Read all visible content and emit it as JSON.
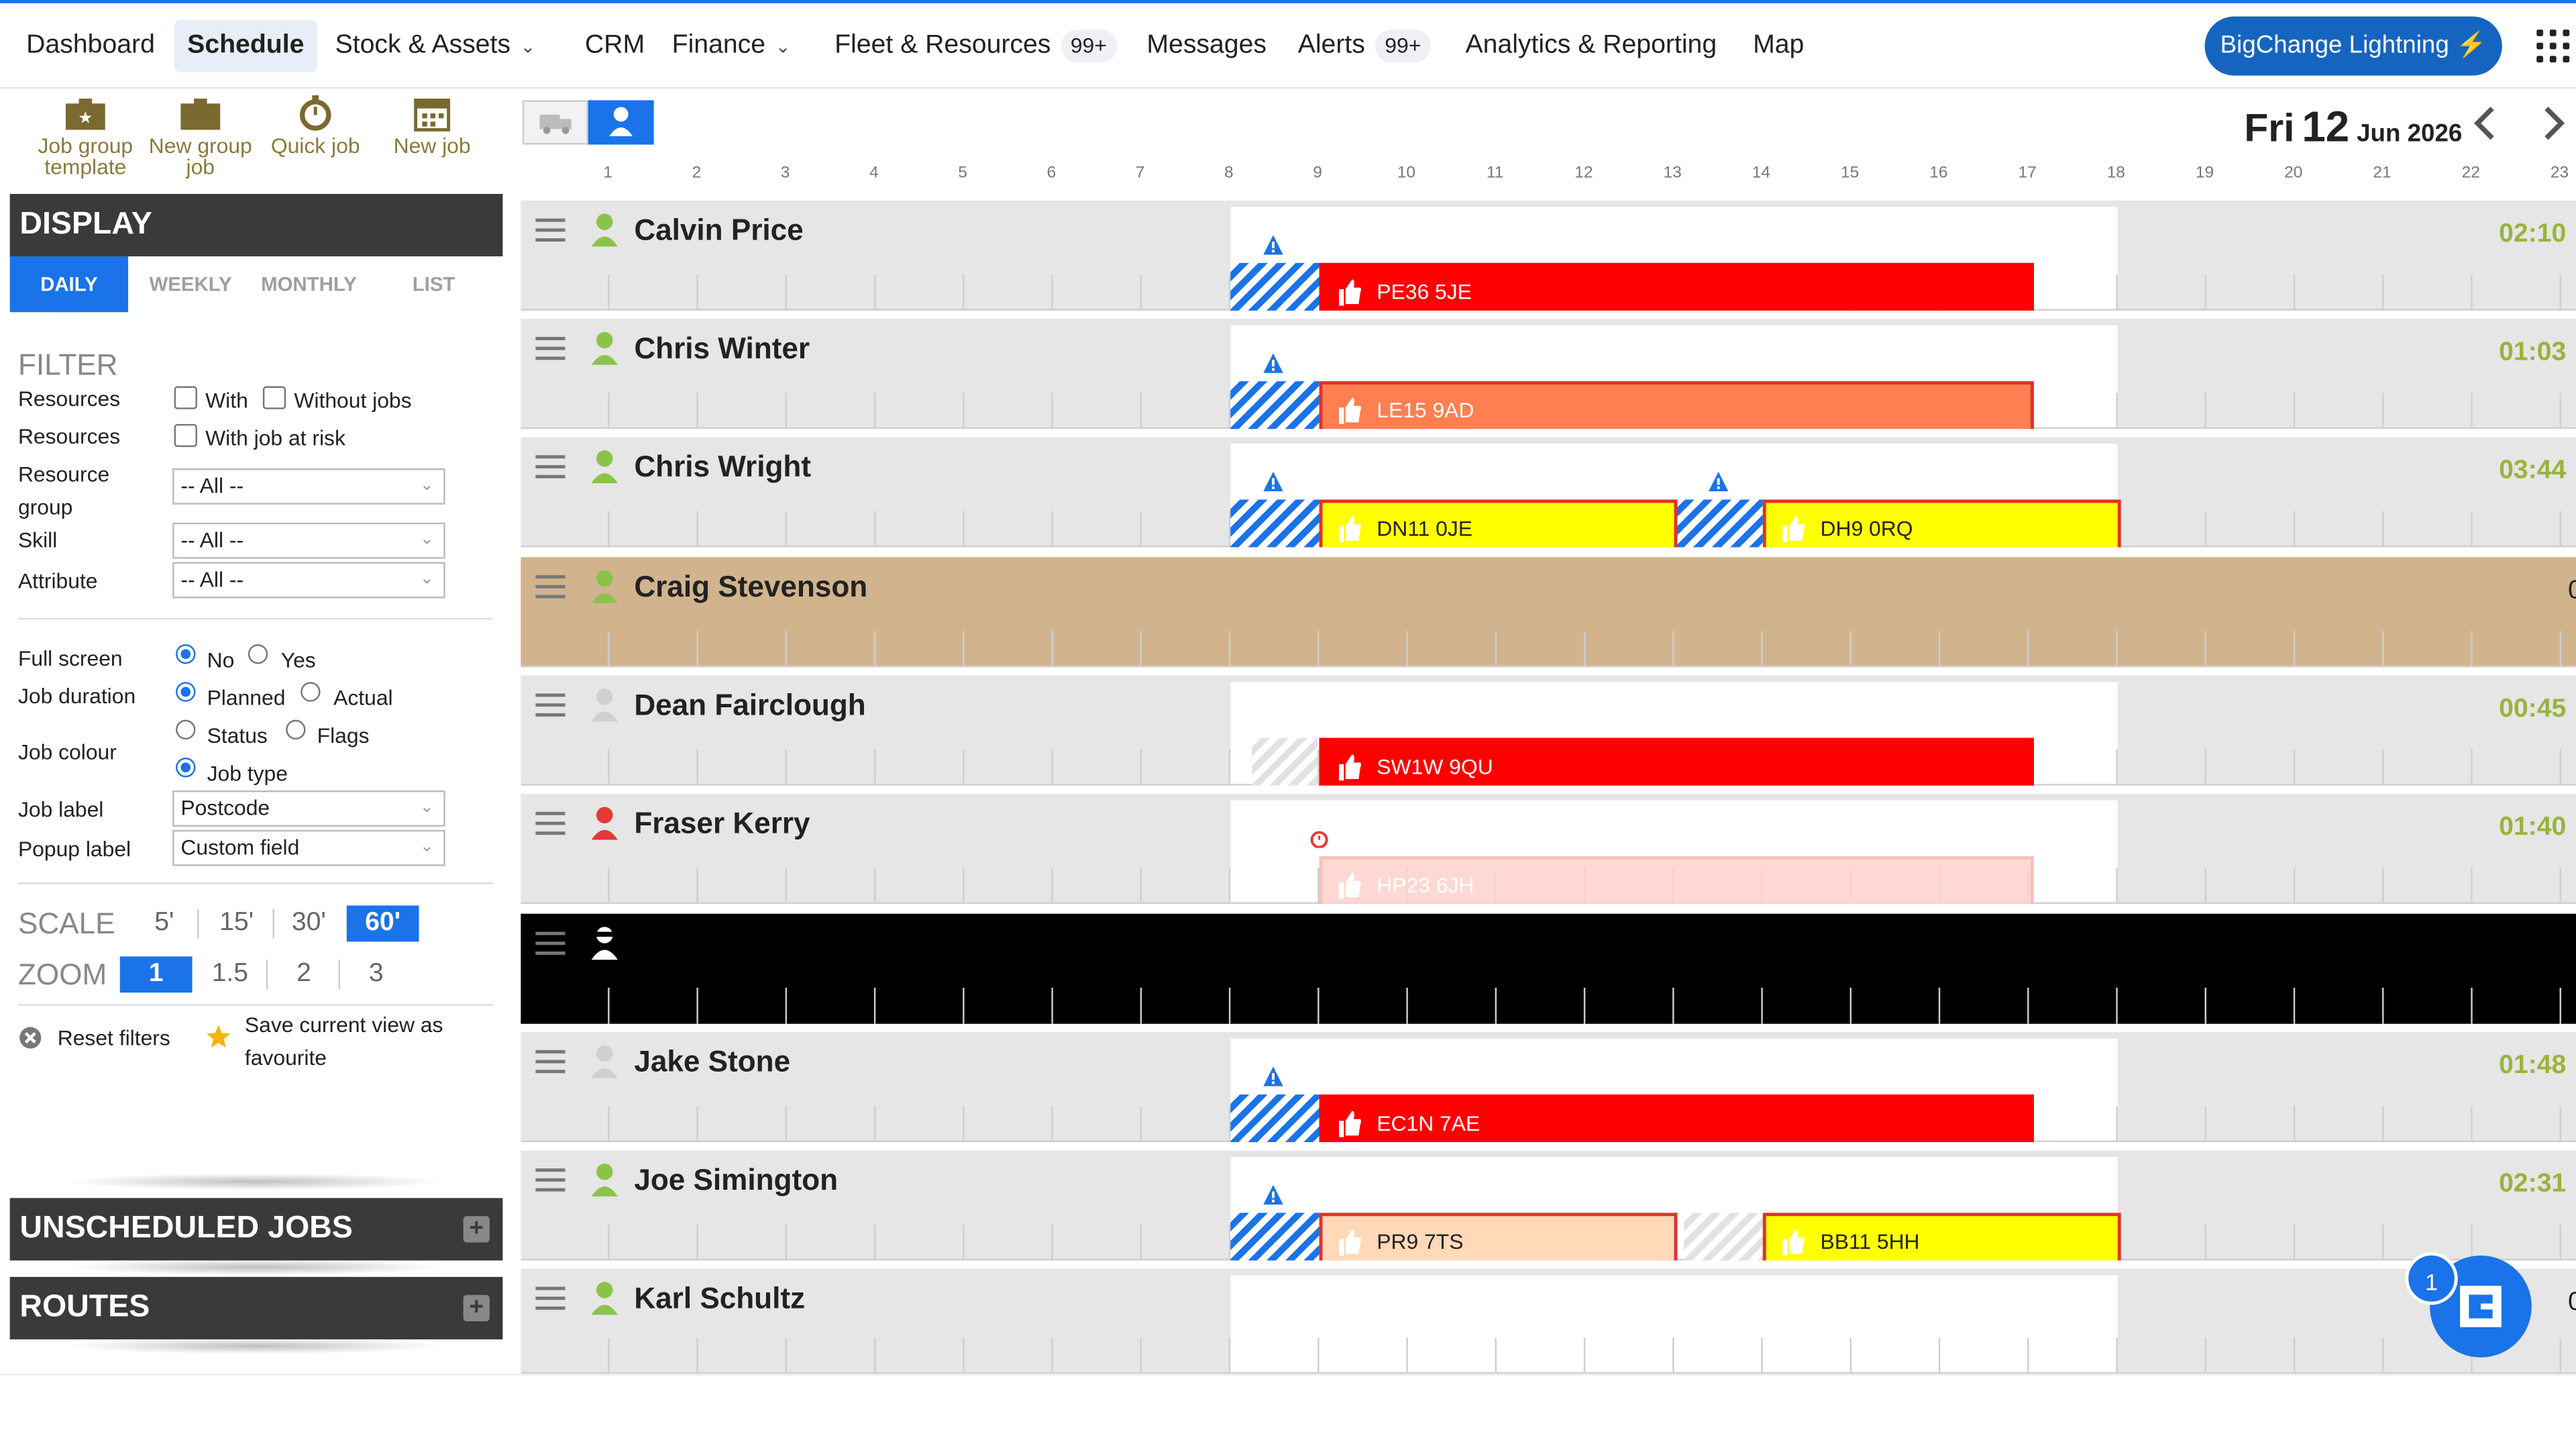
{
  "nav": {
    "items": [
      {
        "label": "Dashboard"
      },
      {
        "label": "Schedule"
      },
      {
        "label": "Stock & Assets"
      },
      {
        "label": "CRM"
      },
      {
        "label": "Finance"
      },
      {
        "label": "Fleet & Resources",
        "badge": "99+"
      },
      {
        "label": "Messages"
      },
      {
        "label": "Alerts",
        "badge": "99+"
      },
      {
        "label": "Analytics & Reporting"
      },
      {
        "label": "Map"
      }
    ],
    "lightning_label": "BigChange Lightning ⚡"
  },
  "toolbar": {
    "job_group_template": "Job group template",
    "new_group_job": "New group job",
    "quick_job": "Quick job",
    "new_job": "New job"
  },
  "date": {
    "day": "Fri",
    "num": "12",
    "monthyear": "Jun 2026"
  },
  "hours": [
    "1",
    "2",
    "3",
    "4",
    "5",
    "6",
    "7",
    "8",
    "9",
    "10",
    "11",
    "12",
    "13",
    "14",
    "15",
    "16",
    "17",
    "18",
    "19",
    "20",
    "21",
    "22",
    "23"
  ],
  "display": {
    "title": "DISPLAY",
    "tabs": [
      "DAILY",
      "WEEKLY",
      "MONTHLY",
      "LIST"
    ],
    "filter_title": "FILTER",
    "resources_label": "Resources",
    "with_label": "With",
    "without_jobs_label": "Without jobs",
    "resources2_label": "Resources",
    "with_job_at_risk_label": "With job at risk",
    "resource_group_label": "Resource group",
    "resource_group_value": "-- All --",
    "skill_label": "Skill",
    "skill_value": "-- All --",
    "attribute_label": "Attribute",
    "attribute_value": "-- All --",
    "full_screen_label": "Full screen",
    "no_label": "No",
    "yes_label": "Yes",
    "job_duration_label": "Job duration",
    "planned_label": "Planned",
    "actual_label": "Actual",
    "job_colour_label": "Job colour",
    "status_label": "Status",
    "flags_label": "Flags",
    "job_type_label": "Job type",
    "job_label_label": "Job label",
    "job_label_value": "Postcode",
    "popup_label_label": "Popup label",
    "popup_label_value": "Custom field",
    "scale_label": "SCALE",
    "scale_options": [
      "5'",
      "15'",
      "30'",
      "60'"
    ],
    "zoom_label": "ZOOM",
    "zoom_options": [
      "1",
      "1.5",
      "2",
      "3"
    ],
    "reset_filters": "Reset filters",
    "save_view": "Save current view as favourite"
  },
  "unscheduled_title": "UNSCHEDULED JOBS",
  "routes_title": "ROUTES",
  "resources": [
    {
      "name": "Calvin Price",
      "time": "02:10"
    },
    {
      "name": "Chris Winter",
      "time": "01:03"
    },
    {
      "name": "Chris Wright",
      "time": "03:44"
    },
    {
      "name": "Craig Stevenson",
      "time": "0"
    },
    {
      "name": "Dean Fairclough",
      "time": "00:45"
    },
    {
      "name": "Fraser Kerry",
      "time": "01:40"
    },
    {
      "name": "",
      "time": ""
    },
    {
      "name": "Jake Stone",
      "time": "01:48"
    },
    {
      "name": "Joe Simington",
      "time": "02:31"
    },
    {
      "name": "Karl Schultz",
      "time": "0"
    }
  ],
  "jobs": [
    {
      "code": "PE36 5JE",
      "color": "#ff0000"
    },
    {
      "code": "LE15 9AD",
      "color": "#ff7f50"
    },
    {
      "code": "DN11 0JE",
      "color": "#ffff00"
    },
    {
      "code": "DH9 0RQ",
      "color": "#ffff00"
    },
    {
      "code": "SW1W 9QU",
      "color": "#ff0000"
    },
    {
      "code": "HP23 6JH",
      "color": "#ffd2cc"
    },
    {
      "code": "EC1N 7AE",
      "color": "#ff0000"
    },
    {
      "code": "PR9 7TS",
      "color": "#ffd9b8"
    },
    {
      "code": "BB11 5HH",
      "color": "#ffff00"
    }
  ],
  "chat_badge": "1",
  "colors": {
    "accent": "#1a73e8",
    "row_highlight": "#d1b48e",
    "time_green": "#9ab33a"
  }
}
